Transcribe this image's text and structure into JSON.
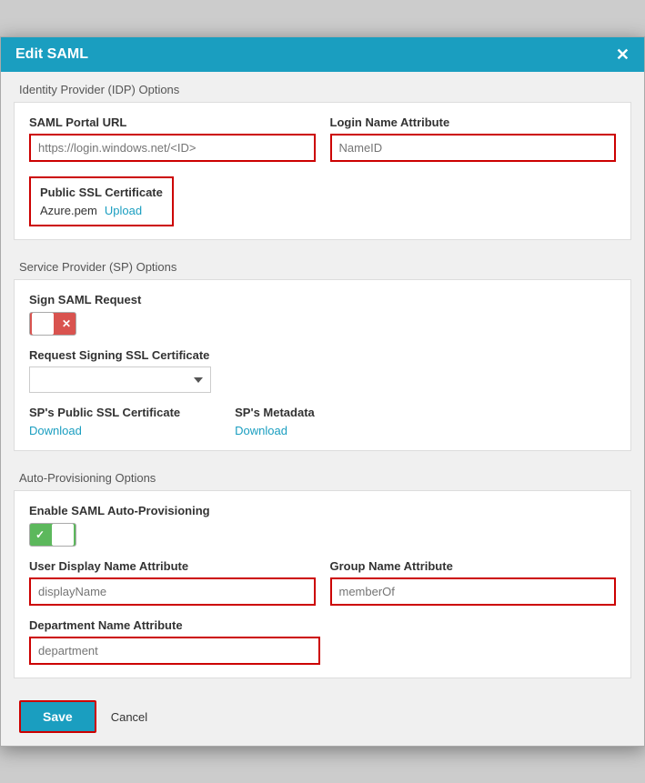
{
  "modal": {
    "title": "Edit SAML",
    "close_label": "✕"
  },
  "idp_section": {
    "label": "Identity Provider (IDP) Options",
    "saml_portal_url": {
      "label": "SAML Portal URL",
      "placeholder": "https://login.windows.net/<ID>",
      "value": ""
    },
    "login_name_attribute": {
      "label": "Login Name Attribute",
      "placeholder": "NameID",
      "value": ""
    },
    "public_ssl_cert": {
      "label": "Public SSL Certificate",
      "filename": "Azure.pem",
      "upload_label": "Upload"
    }
  },
  "sp_section": {
    "label": "Service Provider (SP) Options",
    "sign_saml_request": {
      "label": "Sign SAML Request",
      "enabled": false,
      "toggle_off_icon": "✕"
    },
    "request_signing_ssl": {
      "label": "Request Signing SSL Certificate",
      "placeholder": "",
      "options": [
        ""
      ]
    },
    "public_ssl_cert": {
      "label": "SP's Public SSL Certificate",
      "link_label": "Download"
    },
    "metadata": {
      "label": "SP's Metadata",
      "link_label": "Download"
    }
  },
  "auto_provisioning": {
    "label": "Auto-Provisioning Options",
    "enable_label": "Enable SAML Auto-Provisioning",
    "enabled": true,
    "toggle_on_icon": "✓",
    "user_display_name": {
      "label": "User Display Name Attribute",
      "placeholder": "displayName",
      "value": ""
    },
    "group_name": {
      "label": "Group Name Attribute",
      "placeholder": "memberOf",
      "value": ""
    },
    "department_name": {
      "label": "Department Name Attribute",
      "placeholder": "department",
      "value": ""
    }
  },
  "footer": {
    "save_label": "Save",
    "cancel_label": "Cancel"
  }
}
